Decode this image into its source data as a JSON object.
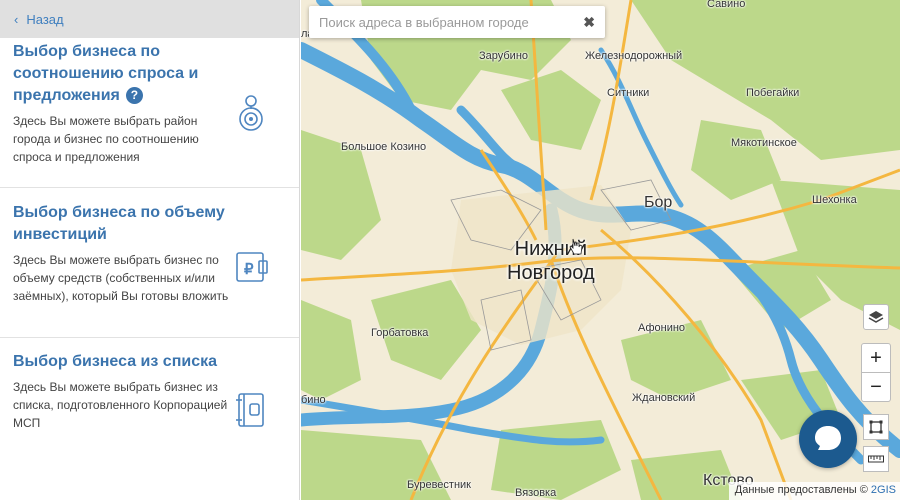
{
  "back": {
    "label": "Назад"
  },
  "options": [
    {
      "title": "Выбор бизнеса по соотношению спроса и предложения",
      "help": "?",
      "description": "Здесь Вы можете выбрать район города и бизнес по соотношению спроса и предложения",
      "icon": "map-pin-icon"
    },
    {
      "title": "Выбор бизнеса по объему инвестиций",
      "description": "Здесь Вы можете выбрать бизнес по объему средств (собственных и/или заёмных), который Вы готовы вложить",
      "icon": "wallet-ruble-icon"
    },
    {
      "title": "Выбор бизнеса из списка",
      "description": "Здесь Вы можете выбрать бизнес из списка, подготовленного Корпорацией МСП",
      "icon": "notebook-icon"
    }
  ],
  "search": {
    "placeholder": "Поиск адреса в выбранном городе",
    "value": ""
  },
  "map": {
    "city": {
      "line1": "Нижний",
      "line2": "Новгород"
    },
    "places": {
      "savino": "Савино",
      "zarubino": "Зарубино",
      "zheleznodorozhny": "Железнодорожный",
      "sitniki": "Ситники",
      "pobegaylo": "Побегайки",
      "bolshoe_kozino": "Большое Козино",
      "myakotinskoe": "Мякотинское",
      "bor": "Бор",
      "shekhonka": "Шехонка",
      "gorbatovka": "Горбатовка",
      "afonino": "Афонино",
      "zhdanovsky": "Ждановский",
      "burevestnik": "Буревестник",
      "vyazovka": "Вязовка",
      "kstovo": "Кстово",
      "edge_top_left": "лахна",
      "edge_left": "бино"
    },
    "attribution": {
      "text": "Данные предоставлены ©",
      "link": "2GIS"
    },
    "colors": {
      "land": "#f3ecd8",
      "forest": "#bcd88a",
      "water": "#5aa8dc",
      "roads": "#f4b740"
    }
  }
}
